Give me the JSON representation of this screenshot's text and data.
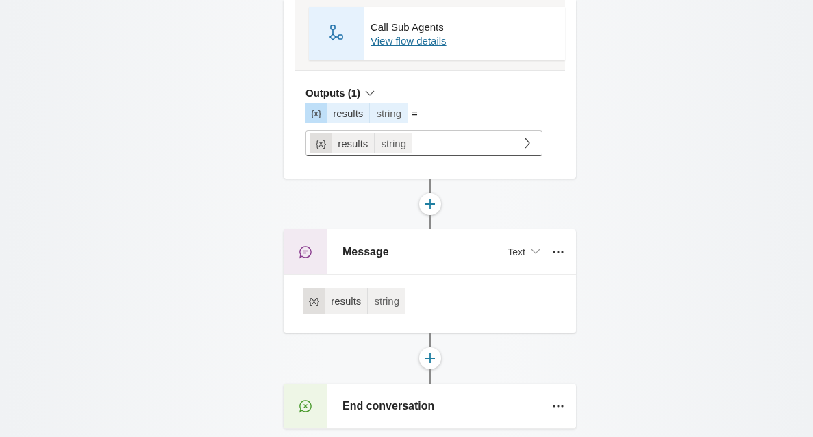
{
  "flow_card": {
    "title": "Call Sub Agents",
    "link": "View flow details"
  },
  "outputs": {
    "label": "Outputs (1)",
    "expanded": true,
    "variable": {
      "icon": "{x}",
      "name": "results",
      "type": "string",
      "selected": true
    },
    "equals": "=",
    "value": {
      "icon": "{x}",
      "name": "results",
      "type": "string",
      "selected": false
    }
  },
  "nodes": [
    {
      "kind": "message",
      "title": "Message",
      "format": "Text",
      "content": {
        "icon": "{x}",
        "name": "results",
        "type": "string",
        "selected": false
      }
    },
    {
      "kind": "end",
      "title": "End conversation"
    }
  ]
}
